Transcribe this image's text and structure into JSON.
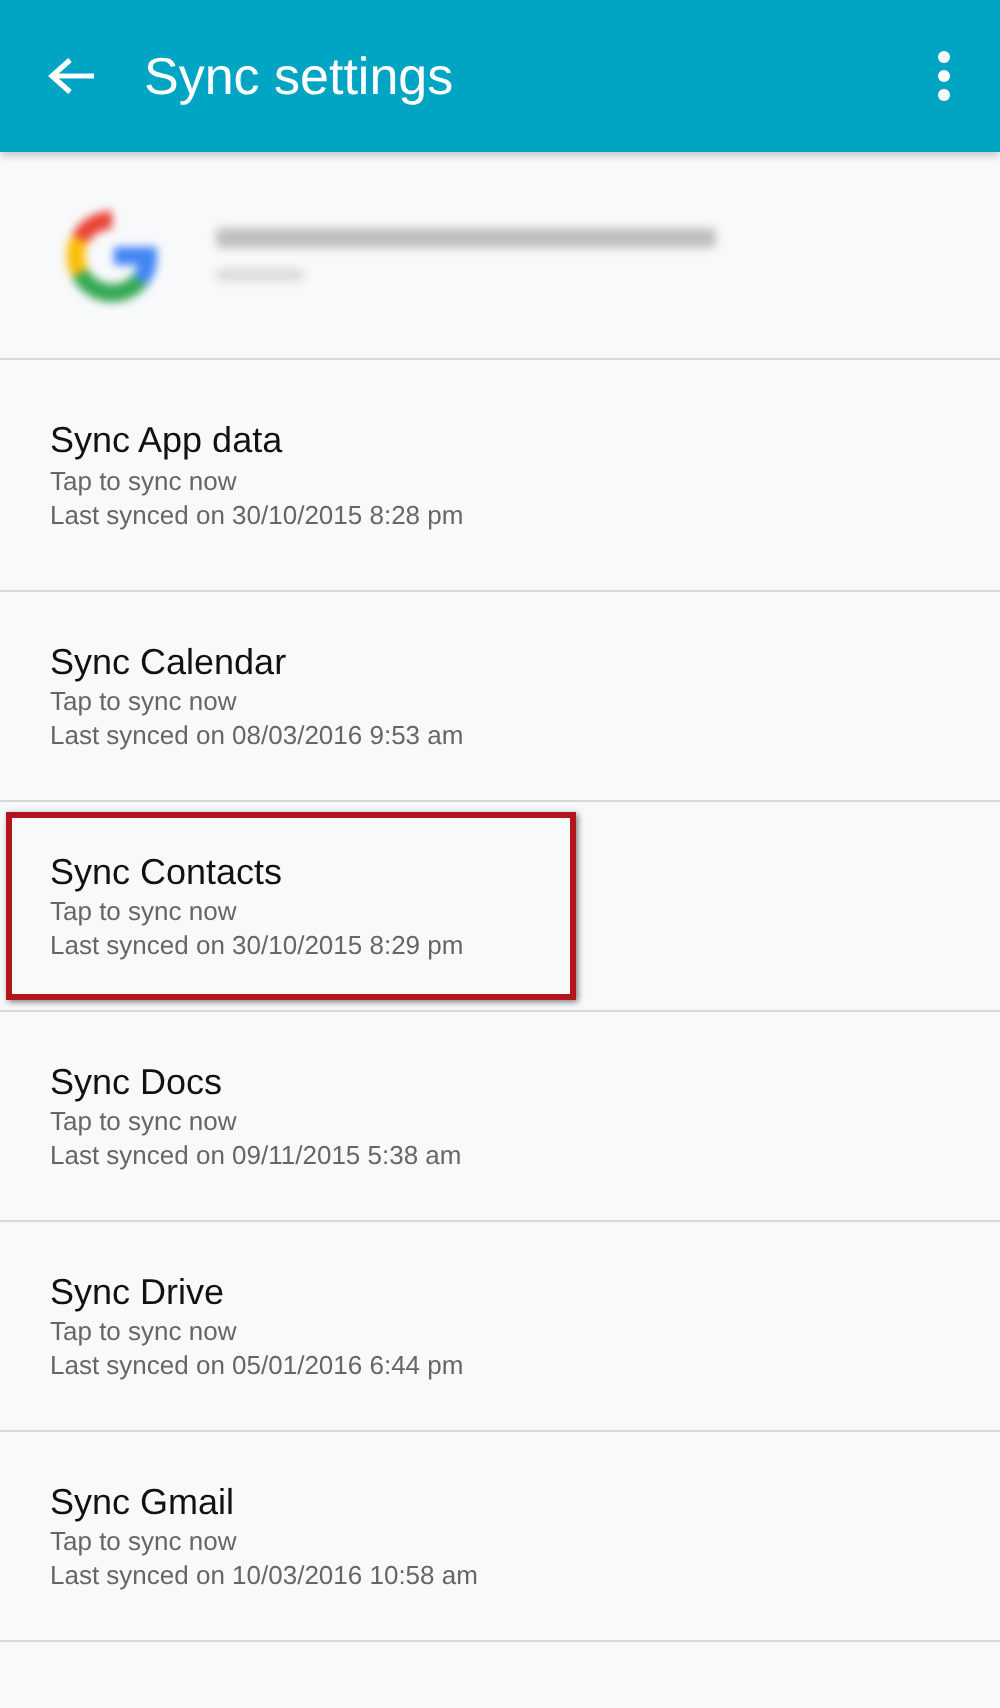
{
  "app_bar": {
    "title": "Sync settings"
  },
  "sync_items": [
    {
      "title": "Sync App data",
      "status": "Tap to sync now",
      "last_synced": "Last synced on 30/10/2015 8:28 pm",
      "highlighted": false
    },
    {
      "title": "Sync Calendar",
      "status": "Tap to sync now",
      "last_synced": "Last synced on 08/03/2016 9:53 am",
      "highlighted": false
    },
    {
      "title": "Sync Contacts",
      "status": "Tap to sync now",
      "last_synced": "Last synced on 30/10/2015 8:29 pm",
      "highlighted": true
    },
    {
      "title": "Sync Docs",
      "status": "Tap to sync now",
      "last_synced": "Last synced on 09/11/2015 5:38 am",
      "highlighted": false
    },
    {
      "title": "Sync Drive",
      "status": "Tap to sync now",
      "last_synced": "Last synced on 05/01/2016 6:44 pm",
      "highlighted": false
    },
    {
      "title": "Sync Gmail",
      "status": "Tap to sync now",
      "last_synced": "Last synced on 10/03/2016 10:58 am",
      "highlighted": false
    }
  ]
}
